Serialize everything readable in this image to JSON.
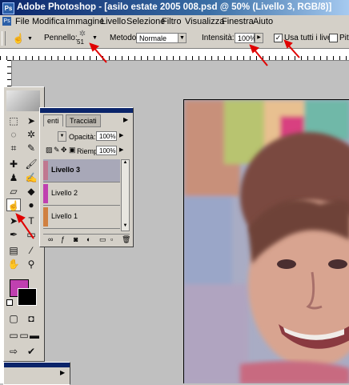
{
  "app": {
    "title": "Adobe Photoshop - [asilo estate 2005 008.psd @ 50% (Livello 3, RGB/8)]",
    "logo_text": "Ps"
  },
  "menu": {
    "items": [
      "File",
      "Modifica",
      "Immagine",
      "Livello",
      "Selezione",
      "Filtro",
      "Visualizza",
      "Finestra",
      "Aiuto"
    ]
  },
  "options": {
    "brush_label": "Pennello:",
    "brush_size": "51",
    "method_label": "Metodo:",
    "method_value": "Normale",
    "intensity_label": "Intensità:",
    "intensity_value": "100%",
    "use_all_layers_label": "Usa tutti i livelli",
    "use_all_layers_checked": "✓",
    "finger_paint_label": "Pittu"
  },
  "layers_panel": {
    "tabs": [
      "enti",
      "Tracciati"
    ],
    "opacity_label": "Opacità:",
    "opacity_value": "100%",
    "fill_label": "Riemp.:",
    "fill_value": "100%",
    "layers": [
      {
        "name": "Livello 3",
        "color": "#c07890",
        "active": true
      },
      {
        "name": "Livello 2",
        "color": "#c040b0",
        "active": false
      },
      {
        "name": "Livello 1",
        "color": "#d08040",
        "active": false
      }
    ]
  },
  "toolbox": {
    "foreground_color": "#c040b0",
    "background_color": "#000000",
    "selected_tool": "smudge-tool"
  },
  "colors": {
    "annotation_arrow": "#e00000",
    "titlebar_start": "#0a246a"
  }
}
